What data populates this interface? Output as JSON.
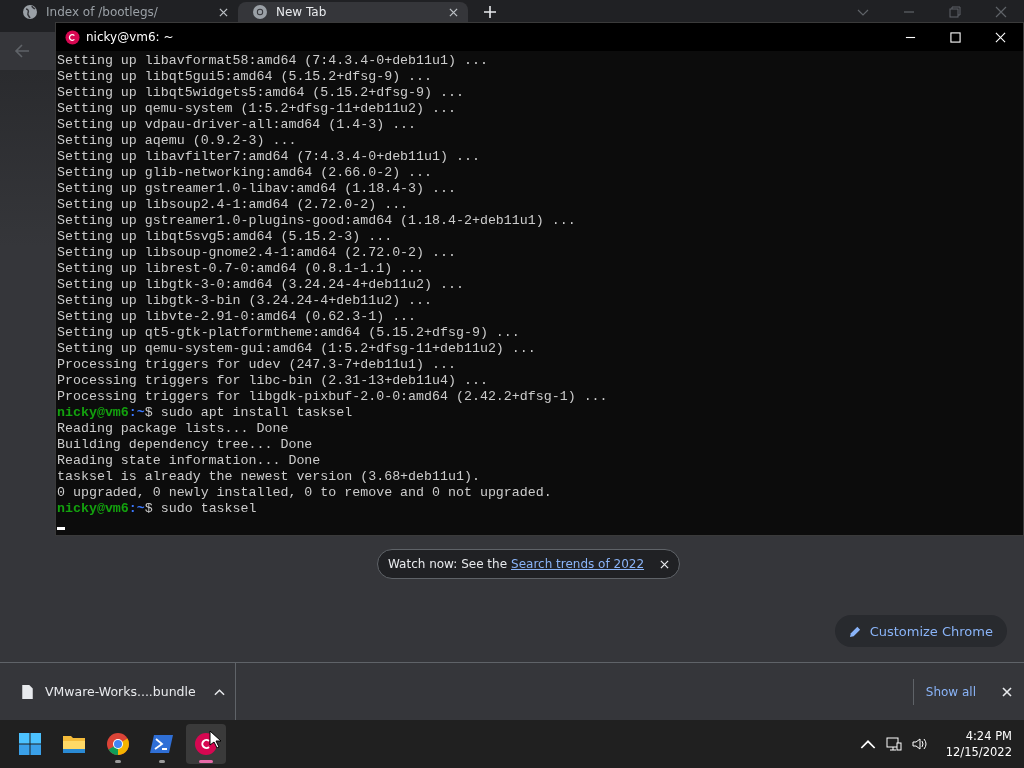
{
  "browser": {
    "tabs": [
      {
        "title": "Index of /bootlegs/",
        "selected": false,
        "kind": "web"
      },
      {
        "title": "New Tab",
        "selected": true,
        "kind": "newtab"
      }
    ],
    "notice": {
      "text": "Watch now: See the",
      "link": "Search trends of 2022"
    },
    "customize_button": "Customize Chrome",
    "download_bar": {
      "file": "VMware-Works....bundle",
      "show_all": "Show all"
    }
  },
  "terminal": {
    "title": "nicky@vm6: ~",
    "lines": [
      {
        "kind": "output",
        "text": "Setting up libavformat58:amd64 (7:4.3.4-0+deb11u1) ..."
      },
      {
        "kind": "output",
        "text": "Setting up libqt5gui5:amd64 (5.15.2+dfsg-9) ..."
      },
      {
        "kind": "output",
        "text": "Setting up libqt5widgets5:amd64 (5.15.2+dfsg-9) ..."
      },
      {
        "kind": "output",
        "text": "Setting up qemu-system (1:5.2+dfsg-11+deb11u2) ..."
      },
      {
        "kind": "output",
        "text": "Setting up vdpau-driver-all:amd64 (1.4-3) ..."
      },
      {
        "kind": "output",
        "text": "Setting up aqemu (0.9.2-3) ..."
      },
      {
        "kind": "output",
        "text": "Setting up libavfilter7:amd64 (7:4.3.4-0+deb11u1) ..."
      },
      {
        "kind": "output",
        "text": "Setting up glib-networking:amd64 (2.66.0-2) ..."
      },
      {
        "kind": "output",
        "text": "Setting up gstreamer1.0-libav:amd64 (1.18.4-3) ..."
      },
      {
        "kind": "output",
        "text": "Setting up libsoup2.4-1:amd64 (2.72.0-2) ..."
      },
      {
        "kind": "output",
        "text": "Setting up gstreamer1.0-plugins-good:amd64 (1.18.4-2+deb11u1) ..."
      },
      {
        "kind": "output",
        "text": "Setting up libqt5svg5:amd64 (5.15.2-3) ..."
      },
      {
        "kind": "output",
        "text": "Setting up libsoup-gnome2.4-1:amd64 (2.72.0-2) ..."
      },
      {
        "kind": "output",
        "text": "Setting up librest-0.7-0:amd64 (0.8.1-1.1) ..."
      },
      {
        "kind": "output",
        "text": "Setting up libgtk-3-0:amd64 (3.24.24-4+deb11u2) ..."
      },
      {
        "kind": "output",
        "text": "Setting up libgtk-3-bin (3.24.24-4+deb11u2) ..."
      },
      {
        "kind": "output",
        "text": "Setting up libvte-2.91-0:amd64 (0.62.3-1) ..."
      },
      {
        "kind": "output",
        "text": "Setting up qt5-gtk-platformtheme:amd64 (5.15.2+dfsg-9) ..."
      },
      {
        "kind": "output",
        "text": "Setting up qemu-system-gui:amd64 (1:5.2+dfsg-11+deb11u2) ..."
      },
      {
        "kind": "output",
        "text": "Processing triggers for udev (247.3-7+deb11u1) ..."
      },
      {
        "kind": "output",
        "text": "Processing triggers for libc-bin (2.31-13+deb11u4) ..."
      },
      {
        "kind": "output",
        "text": "Processing triggers for libgdk-pixbuf-2.0-0:amd64 (2.42.2+dfsg-1) ..."
      },
      {
        "kind": "prompt",
        "user": "nicky@vm6",
        "path": ":~",
        "command": "$ sudo apt install tasksel"
      },
      {
        "kind": "output",
        "text": "Reading package lists... Done"
      },
      {
        "kind": "output",
        "text": "Building dependency tree... Done"
      },
      {
        "kind": "output",
        "text": "Reading state information... Done"
      },
      {
        "kind": "output",
        "text": "tasksel is already the newest version (3.68+deb11u1)."
      },
      {
        "kind": "output",
        "text": "0 upgraded, 0 newly installed, 0 to remove and 0 not upgraded."
      },
      {
        "kind": "prompt",
        "user": "nicky@vm6",
        "path": ":~",
        "command": "$ sudo tasksel"
      },
      {
        "kind": "cursor"
      }
    ]
  },
  "taskbar": {
    "apps": [
      {
        "kind": "start",
        "running": false,
        "active": false
      },
      {
        "kind": "folder",
        "running": false,
        "active": false
      },
      {
        "kind": "chrome",
        "running": true,
        "active": false
      },
      {
        "kind": "shell",
        "running": true,
        "active": false
      },
      {
        "kind": "swirl",
        "running": true,
        "active": true
      }
    ],
    "time": "4:24 PM",
    "date": "12/15/2022"
  }
}
